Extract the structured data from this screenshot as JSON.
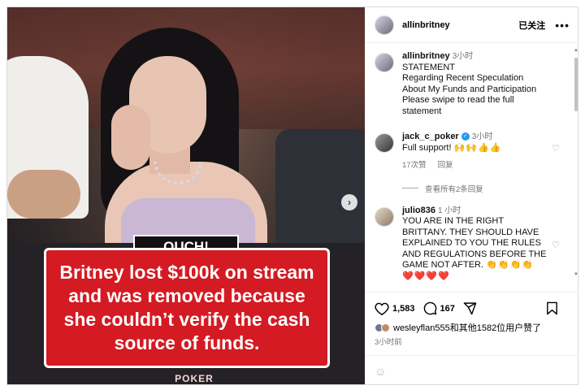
{
  "post": {
    "username": "allinbritney",
    "follow_label": "已关注",
    "more_label": "•••",
    "overlay": {
      "tag": "OUCH!",
      "headline": "Britney lost $100k on stream and was removed because she couldn’t verify the cash source of funds.",
      "logo": "POKER"
    }
  },
  "caption": {
    "username": "allinbritney",
    "time": "3小时",
    "lines": [
      "STATEMENT",
      "Regarding Recent Speculation",
      "About My Funds and Participation",
      "Please swipe to read the full",
      "statement"
    ]
  },
  "comments": [
    {
      "username": "jack_c_poker",
      "verified": true,
      "time": "3小时",
      "text": "Full support! ",
      "emoji": "🙌🙌👍👍",
      "likes_label": "17次赞",
      "reply_label": "回复"
    },
    {
      "username": "julio836",
      "time": "1 小时",
      "text": "YOU ARE IN THE RIGHT BRITTANY. THEY SHOULD HAVE EXPLAINED TO YOU THE RULES AND REGULATIONS BEFORE THE GAME NOT AFTER. ",
      "emoji": "👏👏👏👏",
      "emoji2": "❤️❤️❤️❤️"
    }
  ],
  "view_replies_label": "查看所有2条回复",
  "actions": {
    "likes_count": "1,583",
    "comments_count": "167"
  },
  "liked_by": {
    "text": "wesleyflan555和其他1582位用户赞了"
  },
  "posted_ago": "3小时前",
  "compose": {
    "placeholder": ""
  },
  "icons": {
    "next": "chevron-right-icon",
    "heart": "heart-icon",
    "comment": "comment-icon",
    "share": "share-icon",
    "bookmark": "bookmark-icon",
    "emoji": "emoji-icon"
  },
  "colors": {
    "overlay_red": "#d41a22",
    "verified_blue": "#1d9bf0",
    "muted_text": "#737373"
  }
}
